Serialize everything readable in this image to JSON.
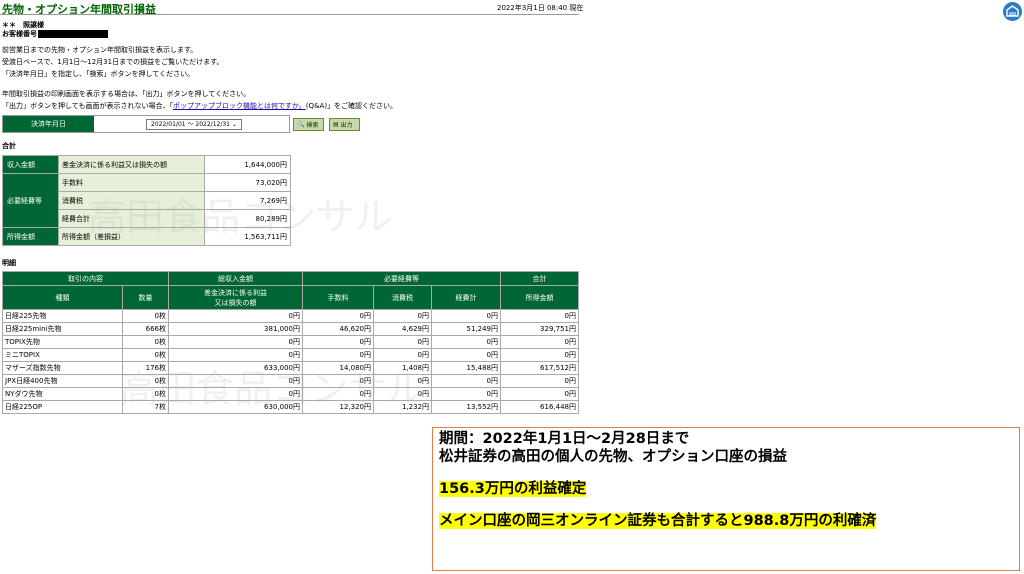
{
  "header": {
    "title": "先物・オプション年間取引損益",
    "timestamp": "2022年3月1日 08:40 現在"
  },
  "customer": {
    "rank": "＊＊　照譲様",
    "number_label": "お客様番号"
  },
  "intro": {
    "line1": "前営業日までの先物・オプション年間取引損益を表示します。",
    "line2": "受渡日ベースで、1月1日～12月31日までの損益をご覧いただけます。",
    "line3": "「決済年月日」を指定し、「検索」ボタンを押してください。",
    "line4": "年間取引損益の印刷画面を表示する場合は、「出力」ボタンを押してください。",
    "line5_pre": "「出力」ボタンを押しても画面が表示されない場合、「",
    "line5_link": "ポップアップブロック機能とは何ですか。",
    "line5_post": "(Q&A)」をご確認ください。"
  },
  "filter": {
    "label": "決済年月日",
    "value": "2022/01/01 ～ 2022/12/31",
    "search_label": "検索",
    "print_label": "出力"
  },
  "summary": {
    "heading": "合計",
    "income_label": "収入金額",
    "income_desc": "差金決済に係る利益又は損失の額",
    "income_value": "1,644,000円",
    "expense_label": "必要経費等",
    "fee_label": "手数料",
    "fee_value": "73,020円",
    "tax_label": "消費税",
    "tax_value": "7,269円",
    "exp_total_label": "経費合計",
    "exp_total_value": "80,289円",
    "profit_label": "所得金額",
    "profit_desc": "所得金額（差損益）",
    "profit_value": "1,563,711円"
  },
  "detail": {
    "heading": "明細",
    "group_headers": [
      "取引の内容",
      "総収入金額",
      "必要経費等",
      "合計"
    ],
    "col_kind": "種類",
    "col_qty": "数量",
    "col_income_1": "差金決済に係る利益",
    "col_income_2": "又は損失の額",
    "col_fee": "手数料",
    "col_tax": "消費税",
    "col_exp": "経費計",
    "col_profit": "所得金額",
    "rows": [
      [
        "日経225先物",
        "0枚",
        "0円",
        "0円",
        "0円",
        "0円",
        "0円"
      ],
      [
        "日経225mini先物",
        "666枚",
        "381,000円",
        "46,620円",
        "4,629円",
        "51,249円",
        "329,751円"
      ],
      [
        "TOPIX先物",
        "0枚",
        "0円",
        "0円",
        "0円",
        "0円",
        "0円"
      ],
      [
        "ミニTOPIX",
        "0枚",
        "0円",
        "0円",
        "0円",
        "0円",
        "0円"
      ],
      [
        "マザーズ指数先物",
        "176枚",
        "633,000円",
        "14,080円",
        "1,408円",
        "15,488円",
        "617,512円"
      ],
      [
        "JPX日経400先物",
        "0枚",
        "0円",
        "0円",
        "0円",
        "0円",
        "0円"
      ],
      [
        "NYダウ先物",
        "0枚",
        "0円",
        "0円",
        "0円",
        "0円",
        "0円"
      ],
      [
        "日経225OP",
        "7枚",
        "630,000円",
        "12,320円",
        "1,232円",
        "13,552円",
        "616,448円"
      ]
    ]
  },
  "watermark": "高田食品コンサル",
  "note": {
    "line1": "期間：2022年1月1日～2月28日まで",
    "line2": "松井証券の高田の個人の先物、オプション口座の損益",
    "line3": "156.3万円の利益確定",
    "line4": "メイン口座の岡三オンライン証券も合計すると988.8万円の利確済"
  },
  "colors": {
    "header_green": "#006633",
    "highlight": "#ffff00",
    "note_border": "#e08040"
  }
}
